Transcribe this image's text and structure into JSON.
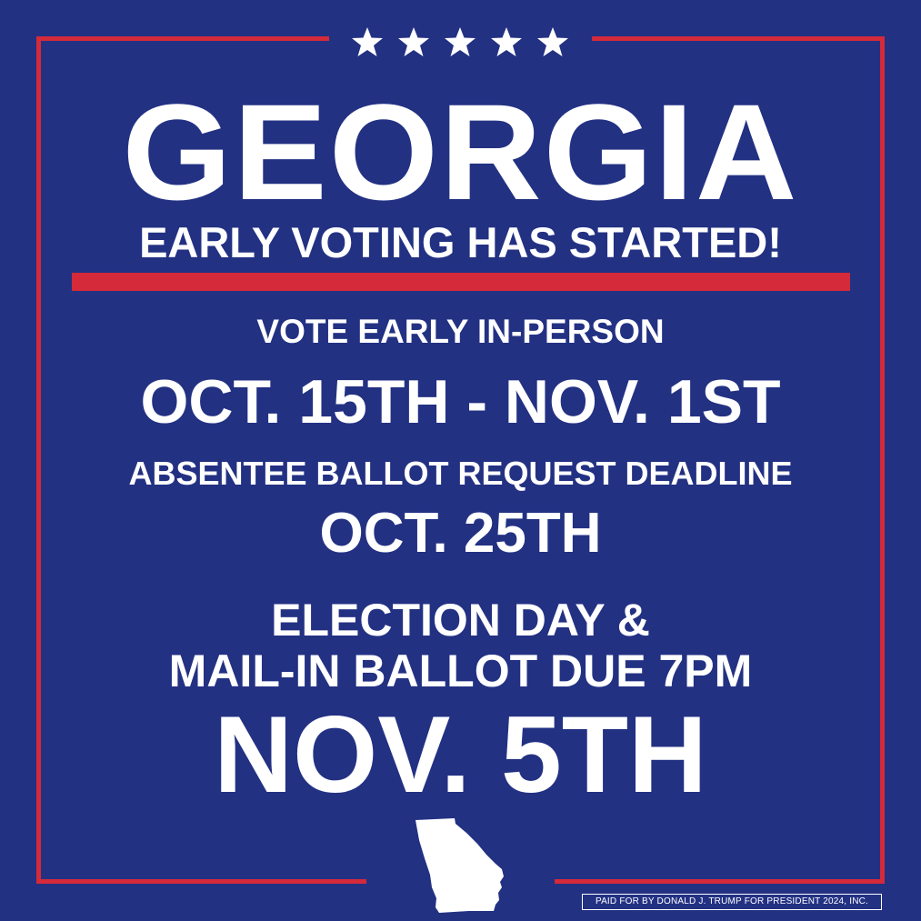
{
  "poster": {
    "stars": "★★★★★",
    "state": "GEORGIA",
    "headline": "EARLY VOTING HAS STARTED!",
    "early_label": "VOTE EARLY IN-PERSON",
    "early_dates": "OCT. 15TH - NOV. 1ST",
    "absentee_label": "ABSENTEE BALLOT REQUEST DEADLINE",
    "absentee_date": "OCT. 25TH",
    "election_line1": "ELECTION DAY &",
    "election_line2": "MAIL-IN BALLOT DUE 7PM",
    "election_date": "NOV. 5TH",
    "disclaimer": "PAID FOR BY DONALD J. TRUMP FOR PRESIDENT 2024, INC."
  },
  "colors": {
    "background": "#233183",
    "accent_red": "#d42a3a",
    "text": "#ffffff"
  },
  "icons": {
    "stars": "star-icon",
    "state_outline": "georgia-state-icon"
  }
}
